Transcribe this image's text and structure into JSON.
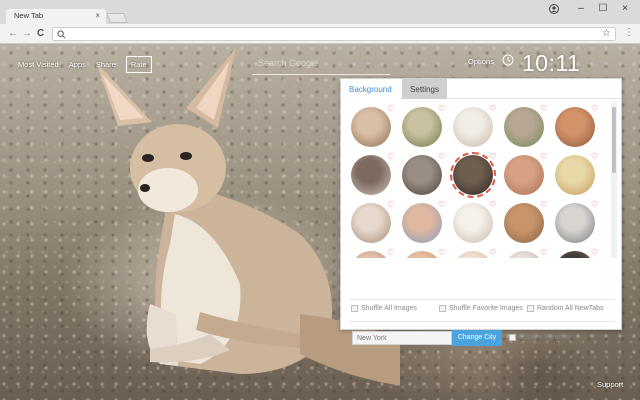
{
  "browser": {
    "tab_title": "New Tab",
    "tab_close": "×",
    "window_controls": [
      "–",
      "☐",
      "×"
    ],
    "nav": {
      "back": "←",
      "forward": "→",
      "reload": "C"
    },
    "star_icon": "☆",
    "menu_icon": "⋮"
  },
  "page": {
    "links": [
      "Most Visited",
      "Apps",
      "Share"
    ],
    "rate_label": "Rate",
    "search_placeholder": "Search Google",
    "options_label": "Options",
    "clock": "10:11",
    "support_label": "Support"
  },
  "panel": {
    "tabs": [
      "Background",
      "Settings"
    ],
    "active_tab": "Background",
    "thumbnails": [
      {
        "c1": "#d9bfa5",
        "c2": "#8a6e55"
      },
      {
        "c1": "#c8c0a0",
        "c2": "#6e7a4c"
      },
      {
        "c1": "#f0ece6",
        "c2": "#c9b8a4"
      },
      {
        "c1": "#b8a694",
        "c2": "#6f8a54"
      },
      {
        "c1": "#d4926a",
        "c2": "#8a5a3a"
      },
      {
        "c1": "#7c6a60",
        "c2": "#cfc3b8"
      },
      {
        "c1": "#9a8e84",
        "c2": "#4a423c"
      },
      {
        "c1": "#6e5e50",
        "c2": "#2e2620"
      },
      {
        "c1": "#d9a184",
        "c2": "#a87050"
      },
      {
        "c1": "#e8d8a8",
        "c2": "#c79a5c"
      },
      {
        "c1": "#e6d8cc",
        "c2": "#a88a70"
      },
      {
        "c1": "#e0b8a0",
        "c2": "#8a9ac0"
      },
      {
        "c1": "#f4f0ea",
        "c2": "#c8b8a8"
      },
      {
        "c1": "#c9946c",
        "c2": "#8a6446"
      },
      {
        "c1": "#d8d4d0",
        "c2": "#7a7a80"
      },
      {
        "c1": "#e0c0a8",
        "c2": "#a07858"
      },
      {
        "c1": "#e8c0a0",
        "c2": "#b08060"
      },
      {
        "c1": "#f0e0d0",
        "c2": "#c8a888"
      },
      {
        "c1": "#e8e0d8",
        "c2": "#a8a098"
      },
      {
        "c1": "#3c3c3c",
        "c2": "#c87838"
      }
    ],
    "selected_thumbnail": 7,
    "heart_icon": "♡",
    "shuffle_all": "Shuffle All Images",
    "shuffle_fav": "Shuffle Favorite Images",
    "random_all": "Random All NewTabs",
    "city_value": "New York",
    "change_city": "Change City",
    "disable_weather": "Disable Weather"
  },
  "colors": {
    "accent": "#4aa3df",
    "tab_active": "#3f8ed6",
    "heart": "#e05a4a"
  }
}
